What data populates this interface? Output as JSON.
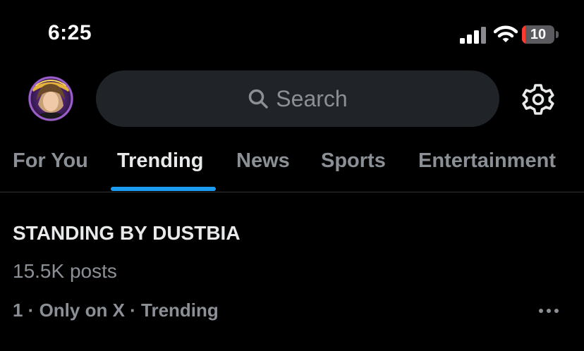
{
  "status_bar": {
    "time": "6:25",
    "battery_level": "10",
    "battery_fraction": 0.1,
    "signal_icon": "cellular-signal-icon",
    "wifi_icon": "wifi-icon"
  },
  "header": {
    "avatar_icon": "profile-avatar",
    "search_placeholder": "Search",
    "search_icon": "search-icon",
    "settings_icon": "gear-icon"
  },
  "tabs": [
    {
      "label": "For You",
      "active": false
    },
    {
      "label": "Trending",
      "active": true
    },
    {
      "label": "News",
      "active": false
    },
    {
      "label": "Sports",
      "active": false
    },
    {
      "label": "Entertainment",
      "active": false
    }
  ],
  "trends": [
    {
      "title": "STANDING BY DUSTBIA",
      "post_count": "15.5K posts",
      "meta": "1 · Only on X · Trending",
      "more_icon": "more-horizontal-icon"
    }
  ],
  "colors": {
    "background": "#000000",
    "primary_text": "#e7e9ea",
    "secondary_text": "#8b9096",
    "accent": "#1d9bf0",
    "search_bg": "#202327",
    "battery_low": "#ff3b30"
  }
}
